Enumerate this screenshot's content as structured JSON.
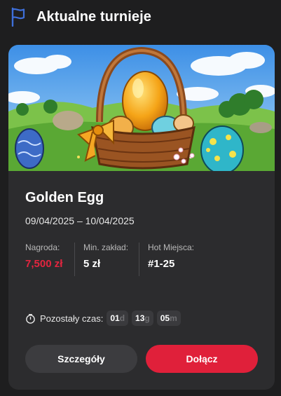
{
  "header": {
    "title": "Aktualne turnieje"
  },
  "tournament": {
    "name": "Golden Egg",
    "dates": "09/04/2025 – 10/04/2025",
    "stats": [
      {
        "label": "Nagroda:",
        "value": "7,500 zł"
      },
      {
        "label": "Min. zakład:",
        "value": "5 zł"
      },
      {
        "label": "Hot Miejsca:",
        "value": "#1-25"
      }
    ],
    "timer": {
      "label": "Pozostały czas:",
      "parts": [
        {
          "value": "01",
          "unit": "d"
        },
        {
          "value": "13",
          "unit": "g"
        },
        {
          "value": "05",
          "unit": "m"
        }
      ]
    },
    "buttons": {
      "details": "Szczegóły",
      "join": "Dołącz"
    }
  },
  "colors": {
    "accent": "#e0203a",
    "prize": "#e3253f",
    "flag": "#3e6fd9"
  },
  "icons": {
    "header": "flag-icon",
    "timer": "stopwatch-icon"
  }
}
